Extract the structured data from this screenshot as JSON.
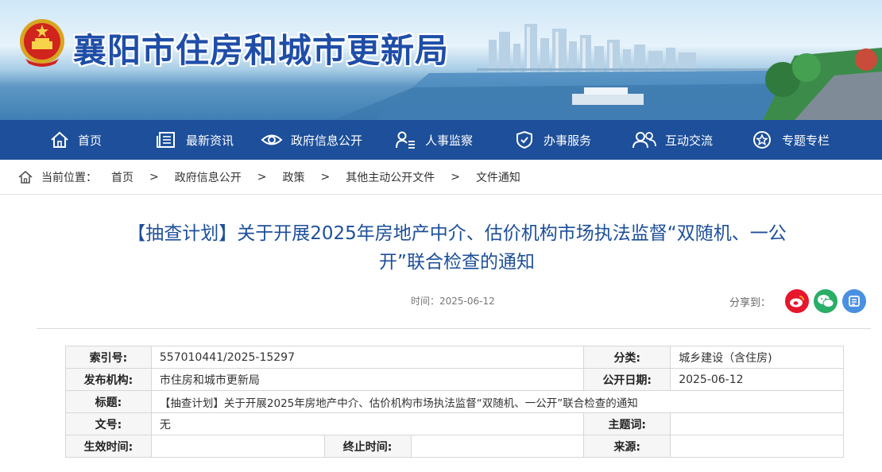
{
  "header": {
    "site_title": "襄阳市住房和城市更新局",
    "emblem_icon": "national-emblem-icon",
    "brand_color": "#1d4f9a"
  },
  "nav": {
    "items": [
      {
        "label": "首页",
        "icon": "home-icon"
      },
      {
        "label": "最新资讯",
        "icon": "news-icon"
      },
      {
        "label": "政府信息公开",
        "icon": "eye-icon"
      },
      {
        "label": "人事监察",
        "icon": "person-list-icon"
      },
      {
        "label": "办事服务",
        "icon": "shield-icon"
      },
      {
        "label": "互动交流",
        "icon": "people-icon"
      },
      {
        "label": "专题专栏",
        "icon": "star-icon"
      }
    ]
  },
  "breadcrumb": {
    "prefix": "当前位置：",
    "separator": ">",
    "items": [
      "首页",
      "政府信息公开",
      "政策",
      "其他主动公开文件",
      "文件通知"
    ]
  },
  "article": {
    "title_line1": "【抽查计划】关于开展2025年房地产中介、估价机构市场执法监督“双随机、一公",
    "title_line2": "开”联合检查的通知",
    "time_label": "时间：",
    "time_value": "2025-06-12",
    "share_label": "分享到："
  },
  "share": {
    "items": [
      {
        "icon": "weibo-icon",
        "color": "#e6162d"
      },
      {
        "icon": "wechat-icon",
        "color": "#2aae67"
      },
      {
        "icon": "qzone-icon",
        "color": "#4a90e2"
      }
    ]
  },
  "info": {
    "index_label": "索引号:",
    "index_value": "557010441/2025-15297",
    "category_label": "分类:",
    "category_value": "城乡建设（含住房)",
    "publisher_label": "发布机构:",
    "publisher_value": "市住房和城市更新局",
    "date_label": "公开日期:",
    "date_value": "2025-06-12",
    "title_label": "标题:",
    "title_value": "【抽查计划】关于开展2025年房地产中介、估价机构市场执法监督“双随机、一公开”联合检查的通知",
    "docno_label": "文号:",
    "docno_value": "无",
    "keywords_label": "主题词:",
    "keywords_value": "",
    "effective_label": "生效时间:",
    "effective_value": "",
    "end_label": "终止时间:",
    "end_value": "",
    "source_label": "来源:",
    "source_value": ""
  }
}
